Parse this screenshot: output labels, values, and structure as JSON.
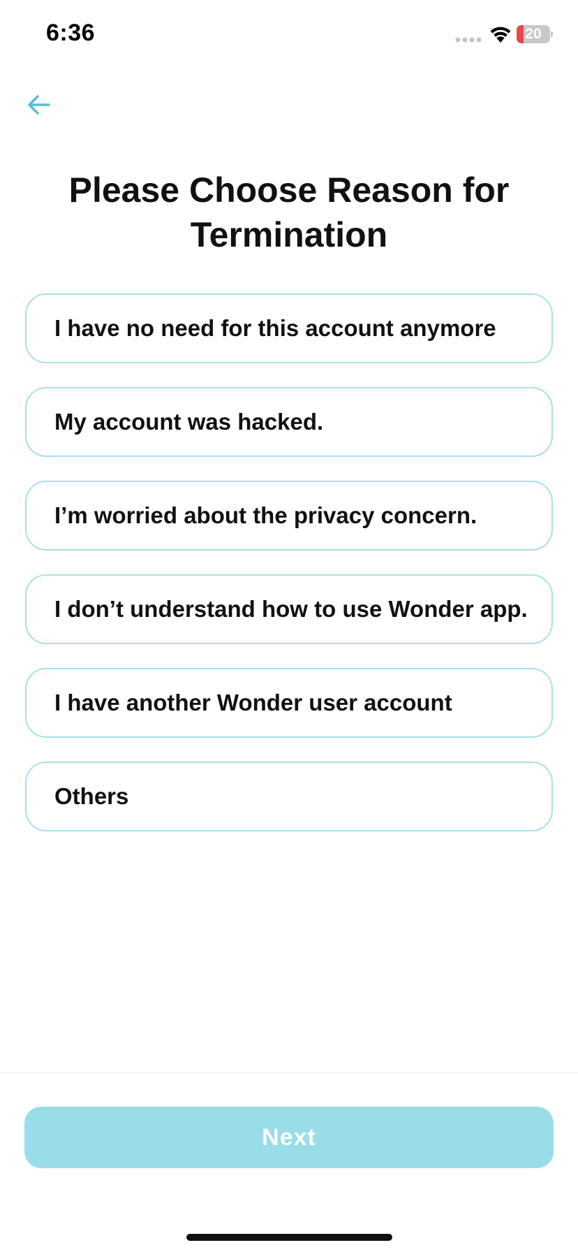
{
  "status_bar": {
    "time": "6:36",
    "battery_level": "20",
    "battery_fraction": 0.2,
    "battery_color": "#e5484d"
  },
  "header": {
    "back_icon": "arrow-left-icon",
    "title": "Please Choose Reason for Termination"
  },
  "reasons": [
    {
      "label": "I have no need for this account anymore"
    },
    {
      "label": "My account was hacked."
    },
    {
      "label": "I’m worried about the privacy concern."
    },
    {
      "label": "I don’t understand how to use Wonder app."
    },
    {
      "label": "I have another Wonder user account"
    },
    {
      "label": "Others"
    }
  ],
  "footer": {
    "next_label": "Next"
  },
  "colors": {
    "accent": "#5bbdd4",
    "option_border": "#a9e0ea",
    "button_disabled": "#98dde8"
  }
}
